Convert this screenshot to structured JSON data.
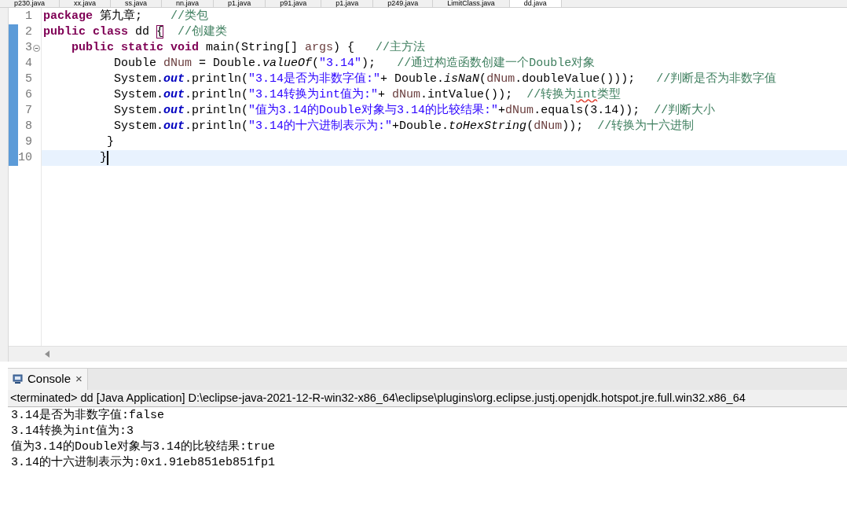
{
  "editor_tabs": [
    {
      "label": "p230.java",
      "selected": false
    },
    {
      "label": "xx.java",
      "selected": false
    },
    {
      "label": "ss.java",
      "selected": false
    },
    {
      "label": "nn.java",
      "selected": false
    },
    {
      "label": "p1.java",
      "selected": false
    },
    {
      "label": "p91.java",
      "selected": false
    },
    {
      "label": "p1.java",
      "selected": false
    },
    {
      "label": "p249.java",
      "selected": false
    },
    {
      "label": "LimitClass.java",
      "selected": false
    },
    {
      "label": "dd.java",
      "selected": true
    }
  ],
  "editor": {
    "lines": [
      {
        "number": "1",
        "changed": false,
        "fold": false,
        "current": false,
        "tokens": [
          {
            "kind": "keyword",
            "text": "package"
          },
          {
            "kind": "plain",
            "text": " 第九章;    "
          },
          {
            "kind": "comment",
            "text": "//类包"
          }
        ]
      },
      {
        "number": "2",
        "changed": true,
        "fold": false,
        "current": false,
        "tokens": [
          {
            "kind": "keyword",
            "text": "public class"
          },
          {
            "kind": "plain",
            "text": " dd "
          },
          {
            "kind": "bracket_match",
            "text": "{"
          },
          {
            "kind": "comment",
            "text": "  //创建类"
          }
        ]
      },
      {
        "number": "3",
        "changed": true,
        "fold": true,
        "current": false,
        "tokens": [
          {
            "kind": "keyword",
            "text": "    public static void"
          },
          {
            "kind": "plain",
            "text": " main(String[] "
          },
          {
            "kind": "local",
            "text": "args"
          },
          {
            "kind": "plain",
            "text": ") {   "
          },
          {
            "kind": "comment",
            "text": "//主方法"
          }
        ]
      },
      {
        "number": "4",
        "changed": true,
        "fold": false,
        "current": false,
        "tokens": [
          {
            "kind": "plain",
            "text": "          Double "
          },
          {
            "kind": "local",
            "text": "dNum"
          },
          {
            "kind": "plain",
            "text": " = Double."
          },
          {
            "kind": "static",
            "text": "valueOf"
          },
          {
            "kind": "plain",
            "text": "("
          },
          {
            "kind": "string",
            "text": "\"3.14\""
          },
          {
            "kind": "plain",
            "text": ");   "
          },
          {
            "kind": "comment",
            "text": "//通过构造函数创建一个Double对象"
          }
        ]
      },
      {
        "number": "5",
        "changed": true,
        "fold": false,
        "current": false,
        "tokens": [
          {
            "kind": "plain",
            "text": "          System."
          },
          {
            "kind": "field",
            "text": "out"
          },
          {
            "kind": "plain",
            "text": ".println("
          },
          {
            "kind": "string",
            "text": "\"3.14是否为非数字值:\""
          },
          {
            "kind": "plain",
            "text": "+ Double."
          },
          {
            "kind": "static",
            "text": "isNaN"
          },
          {
            "kind": "plain",
            "text": "("
          },
          {
            "kind": "local",
            "text": "dNum"
          },
          {
            "kind": "plain",
            "text": ".doubleValue()));   "
          },
          {
            "kind": "comment",
            "text": "//判断是否为非数字值"
          }
        ]
      },
      {
        "number": "6",
        "changed": true,
        "fold": false,
        "current": false,
        "tokens": [
          {
            "kind": "plain",
            "text": "          System."
          },
          {
            "kind": "field",
            "text": "out"
          },
          {
            "kind": "plain",
            "text": ".println("
          },
          {
            "kind": "string",
            "text": "\"3.14转换为int值为:\""
          },
          {
            "kind": "plain",
            "text": "+ "
          },
          {
            "kind": "local",
            "text": "dNum"
          },
          {
            "kind": "plain",
            "text": ".intValue());  "
          },
          {
            "kind": "comment",
            "text": "//转换为"
          },
          {
            "kind": "comment_warning",
            "text": "int"
          },
          {
            "kind": "comment",
            "text": "类型"
          }
        ]
      },
      {
        "number": "7",
        "changed": true,
        "fold": false,
        "current": false,
        "tokens": [
          {
            "kind": "plain",
            "text": "          System."
          },
          {
            "kind": "field",
            "text": "out"
          },
          {
            "kind": "plain",
            "text": ".println("
          },
          {
            "kind": "string",
            "text": "\"值为3.14的Double对象与3.14的比较结果:\""
          },
          {
            "kind": "plain",
            "text": "+"
          },
          {
            "kind": "local",
            "text": "dNum"
          },
          {
            "kind": "plain",
            "text": ".equals(3.14));  "
          },
          {
            "kind": "comment",
            "text": "//判断大小"
          }
        ]
      },
      {
        "number": "8",
        "changed": true,
        "fold": false,
        "current": false,
        "tokens": [
          {
            "kind": "plain",
            "text": "          System."
          },
          {
            "kind": "field",
            "text": "out"
          },
          {
            "kind": "plain",
            "text": ".println("
          },
          {
            "kind": "string",
            "text": "\"3.14的十六进制表示为:\""
          },
          {
            "kind": "plain",
            "text": "+Double."
          },
          {
            "kind": "static",
            "text": "toHexString"
          },
          {
            "kind": "plain",
            "text": "("
          },
          {
            "kind": "local",
            "text": "dNum"
          },
          {
            "kind": "plain",
            "text": "));  "
          },
          {
            "kind": "comment",
            "text": "//转换为十六进制"
          }
        ]
      },
      {
        "number": "9",
        "changed": true,
        "fold": false,
        "current": false,
        "tokens": [
          {
            "kind": "plain",
            "text": "         }"
          }
        ]
      },
      {
        "number": "10",
        "changed": true,
        "fold": false,
        "current": true,
        "tokens": [
          {
            "kind": "plain",
            "text": "        }"
          }
        ]
      }
    ]
  },
  "console": {
    "tab": {
      "label": "Console",
      "close": "×"
    },
    "status": "<terminated> dd [Java Application] D:\\eclipse-java-2021-12-R-win32-x86_64\\eclipse\\plugins\\org.eclipse.justj.openjdk.hotspot.jre.full.win32.x86_64",
    "output": [
      "3.14是否为非数字值:false",
      "3.14转换为int值为:3",
      "值为3.14的Double对象与3.14的比较结果:true",
      "3.14的十六进制表示为:0x1.91eb851eb851fp1"
    ]
  }
}
